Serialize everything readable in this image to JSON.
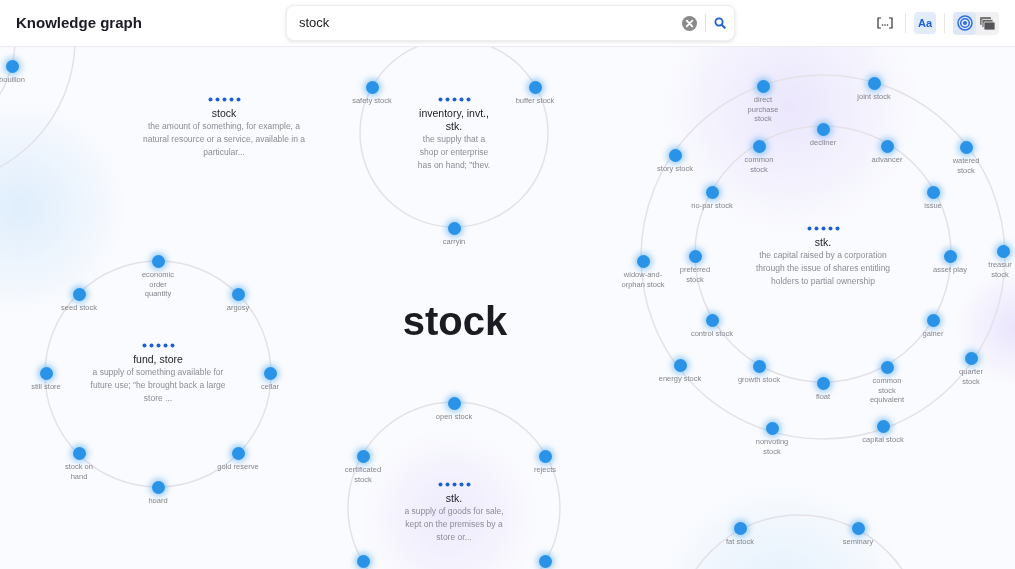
{
  "header": {
    "title": "Knowledge graph",
    "search": {
      "value": "stock"
    },
    "text_size_button": {
      "label": "Aa",
      "selected": true
    },
    "view_modes": [
      {
        "selected": true
      },
      {
        "selected": false
      }
    ]
  },
  "query": "stock",
  "clusters": [
    {
      "nodes": [
        {
          "label": "bouillon"
        }
      ]
    },
    {
      "sense": {
        "title": "stock",
        "definition": "the amount of something, for example, a natural resource or a service, available in a particular..."
      }
    },
    {
      "sense": {
        "title": "inventory, invt., stk.",
        "definition": "the supply that a shop or enterprise has on hand; \"thev."
      },
      "nodes": [
        {
          "label": "safety stock"
        },
        {
          "label": "buffer stock"
        },
        {
          "label": "carryin"
        }
      ]
    },
    {
      "sense": {
        "title": "stk.",
        "definition": "the capital raised by a corporation through the issue of shares entitling holders to partial ownership"
      },
      "nodes": [
        {
          "label": "direct purchase stock"
        },
        {
          "label": "joint stock"
        },
        {
          "label": "decliner"
        },
        {
          "label": "common stock"
        },
        {
          "label": "advancer"
        },
        {
          "label": "story stock"
        },
        {
          "label": "watered stock"
        },
        {
          "label": "no-par stock"
        },
        {
          "label": "issue"
        },
        {
          "label": "preferred stock"
        },
        {
          "label": "asset play"
        },
        {
          "label": "widow-and-orphan stock"
        },
        {
          "label": "treasur stock"
        },
        {
          "label": "control stock"
        },
        {
          "label": "gainer"
        },
        {
          "label": "energy stock"
        },
        {
          "label": "growth stock"
        },
        {
          "label": "float"
        },
        {
          "label": "common stock equivalent"
        },
        {
          "label": "quarter stock"
        },
        {
          "label": "nonvoting stock"
        },
        {
          "label": "capital stock"
        }
      ]
    },
    {
      "sense": {
        "title": "fund, store",
        "definition": "a supply of something available for future use; \"he brought back a large store ..."
      },
      "nodes": [
        {
          "label": "economic order quantity"
        },
        {
          "label": "seed stock"
        },
        {
          "label": "argosy"
        },
        {
          "label": "still store"
        },
        {
          "label": "cellar"
        },
        {
          "label": "stock on hand"
        },
        {
          "label": "gold reserve"
        },
        {
          "label": "hoard"
        }
      ]
    },
    {
      "sense": {
        "title": "stk.",
        "definition": "a supply of goods for sale, kept on the premises by a store or..."
      },
      "nodes": [
        {
          "kind": "labeled",
          "label": "open stock"
        },
        {
          "kind": "labeled",
          "label": "certificated stock"
        },
        {
          "kind": "labeled",
          "label": "rejects"
        },
        {
          "kind": "dot"
        },
        {
          "kind": "dot"
        }
      ]
    },
    {
      "nodes": [
        {
          "label": "fat stock"
        },
        {
          "label": "seminary"
        }
      ]
    }
  ]
}
